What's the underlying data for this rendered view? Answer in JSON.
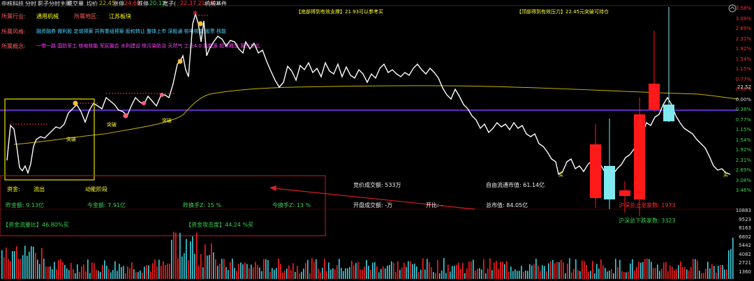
{
  "header": {
    "stock_name": "中核科技",
    "menu": [
      "分时",
      "影子分时主图",
      "成交量"
    ],
    "avg_label": "均价",
    "avg_value": "22.45",
    "limit_up_label": "涨停",
    "limit_up_value": "24.60",
    "limit_down_label": "跌停",
    "limit_down_value": "20.12",
    "shadow_label": "宽子(",
    "shadow_values": "22.37  21.48)",
    "concept": "机械基件"
  },
  "info": {
    "industry_label": "所属行业:",
    "industry_value": "通用机械",
    "region_label": "所属地区:",
    "region_value": "江苏板块",
    "style_label": "所属风格:",
    "style_value": "融资融券 微利股 定增预案 并购重组预案 股权转让 整体上市 深股通 核电核能 股票 核能",
    "concept_label": "所属概念:",
    "concept_value": "一带一路 国防军工 核电核能 军民融合 水利建设 核污染防治 天然气 工业4.0 氢能源 超导概念 振兴东北"
  },
  "banners": {
    "support": "【底部得到有效支撑】21.93可以参考买",
    "pressure": "【顶部得到有效压力】22.45元突破可持仓"
  },
  "signals": {
    "breakout": "突破",
    "buy": "买",
    "sell": "卖"
  },
  "fund_panel": {
    "fund_label": "资金:",
    "outflow": "流出",
    "momentum": "动能阶段",
    "today_amount": "昨金额: 9.13亿",
    "now_amount": "今金额: 7.91亿",
    "yesterday_turnover": "昨换手Z: 15 %",
    "today_turnover": "今换手Z: 13 %",
    "flow_ratio": "【资金流量比】46.80%买",
    "strength": "【资金攻击度】44.24 %买"
  },
  "stats": {
    "auction_volume": "竞价成交额: 533万",
    "open_volume": "开盘成交额: -万",
    "open_ratio": "开比: -",
    "float_cap": "自由流通市值: 61.14亿",
    "total_cap": "总市值: 84.05亿"
  },
  "market": {
    "rise_count": "沪深总上涨家数: 1973",
    "fall_count": "沪深总下跌家数: 3323"
  },
  "right_axis": {
    "price_ticks": [
      "3.58%",
      "3.09%",
      "2.69%",
      "2.31%",
      "1.92%",
      "1.54%",
      "1.15%",
      "0.77%",
      "0.38%",
      "0.00%",
      "0.38%",
      "0.77%",
      "1.15%",
      "1.54%",
      "1.92%",
      "2.31%",
      "2.69%",
      "3.08%",
      "3.46%"
    ],
    "price_label": "22.52",
    "volume_ticks": [
      "10883",
      "9523",
      "8163",
      "6802",
      "5442",
      "4082",
      "2721",
      "1360"
    ]
  },
  "colors": {
    "accent_purple": "#7a3cff",
    "price_line": "#ffffff",
    "avg_line": "#c8b400",
    "up": "#ff1a1a",
    "down": "#7fe8f0"
  }
}
